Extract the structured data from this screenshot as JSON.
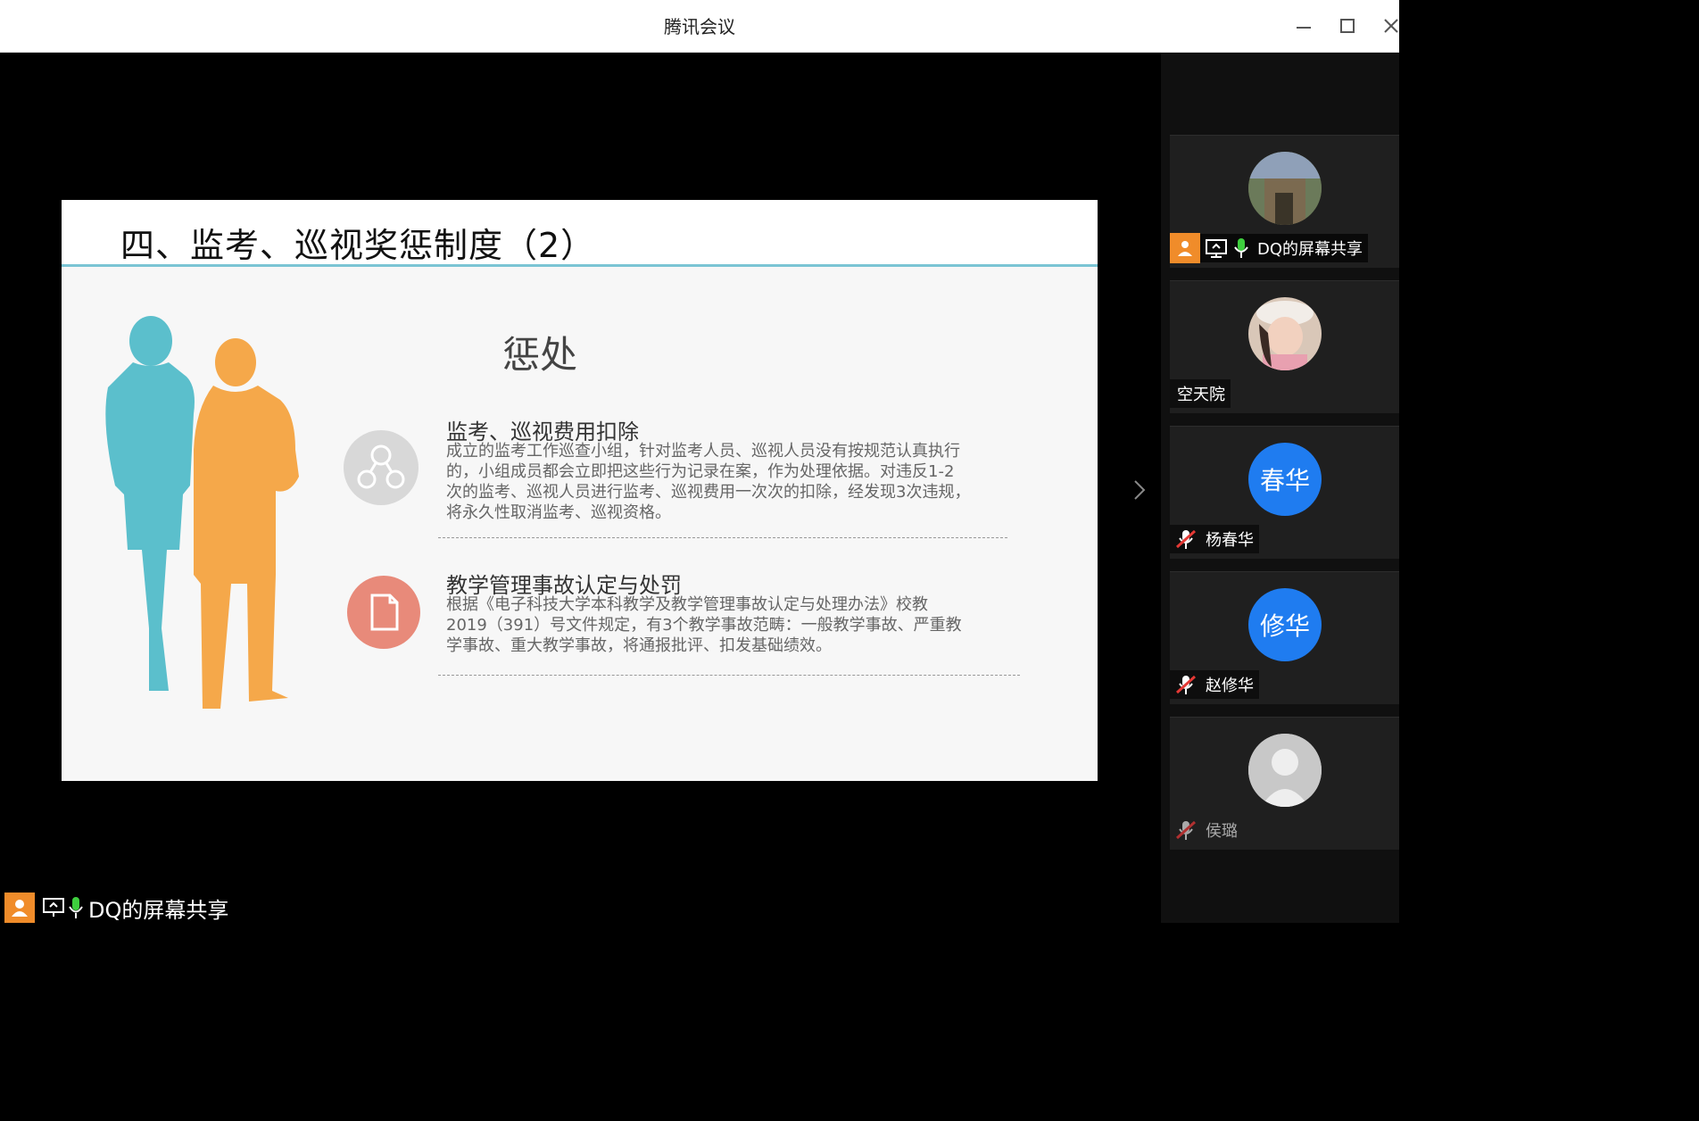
{
  "window": {
    "title": "腾讯会议"
  },
  "slide": {
    "title": "四、监考、巡视奖惩制度（2）",
    "section_title": "惩处",
    "items": [
      {
        "title": "监考、巡视费用扣除",
        "lines": [
          "成立的监考工作巡查小组，针对监考人员、巡视人员没有按规范认真执行",
          "的，小组成员都会立即把这些行为记录在案，作为处理依据。对违反1-2",
          "次的监考、巡视人员进行监考、巡视费用一次次的扣除，经发现3次违规，",
          "将永久性取消监考、巡视资格。"
        ]
      },
      {
        "title": "教学管理事故认定与处罚",
        "lines": [
          "根据《电子科技大学本科教学及教学管理事故认定与处理办法》校教",
          "2019（391）号文件规定，有3个教学事故范畴：一般教学事故、严重教",
          "学事故、重大教学事故，将通报批评、扣发基础绩效。"
        ]
      }
    ]
  },
  "participants": [
    {
      "name": "DQ的屏幕共享",
      "avatar_text": ""
    },
    {
      "name": "空天院",
      "avatar_text": ""
    },
    {
      "name": "杨春华",
      "avatar_text": "春华"
    },
    {
      "name": "赵修华",
      "avatar_text": "修华"
    },
    {
      "name": "侯璐",
      "avatar_text": ""
    }
  ],
  "share_label": "DQ的屏幕共享",
  "colors": {
    "accent": "#1f7cf0",
    "teal": "#5bbfcc",
    "orange": "#f5a84a",
    "salmon": "#e88a7a"
  }
}
